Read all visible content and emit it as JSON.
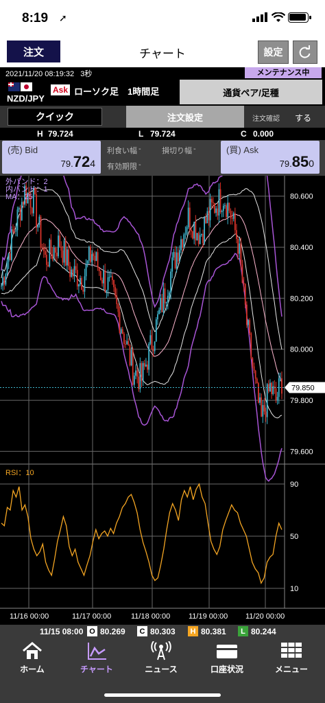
{
  "status_bar": {
    "time": "8:19",
    "location_icon": "location-arrow-icon"
  },
  "header": {
    "order_label": "注文",
    "title": "チャート",
    "settings_label": "設定",
    "refresh_icon": "refresh-icon"
  },
  "info_bar": {
    "datetime": "2021/11/20 08:19:32",
    "interval": "3秒",
    "maintenance": "メンテナンス中"
  },
  "instrument": {
    "pair": "NZD/JPY",
    "ask_tag": "Ask",
    "chart_type": "ローソク足",
    "timeframe": "1時間足",
    "pair_button": "通貨ペア/足種"
  },
  "controls": {
    "quick": "クイック",
    "order_settings": "注文設定",
    "confirm_label": "注文確認",
    "confirm_value": "する"
  },
  "hlc": {
    "h_label": "H",
    "h_value": "79.724",
    "l_label": "L",
    "l_value": "79.724",
    "c_label": "C",
    "c_value": "0.000"
  },
  "quote": {
    "bid_label": "(売) Bid",
    "bid_a": "79.",
    "bid_b": "72",
    "bid_c": "4",
    "ask_label": "(買) Ask",
    "ask_a": "79.",
    "ask_b": "85",
    "ask_c": "0",
    "take_profit": "利食い幅",
    "take_profit_val": "-",
    "stop_loss": "損切り幅",
    "stop_loss_val": "-",
    "expiry": "有効期限",
    "expiry_val": "-"
  },
  "chart_data": [
    {
      "type": "candlestick",
      "indicators": [
        "外バンド：2",
        "内バンド：1",
        "MA：25"
      ],
      "y_ticks": [
        "80.600",
        "80.400",
        "80.200",
        "80.000",
        "79.800",
        "79.600"
      ],
      "ylim": [
        79.55,
        80.68
      ],
      "current_price": "79.850",
      "x_ticks": [
        "11/16 00:00",
        "11/17 00:00",
        "11/18 00:00",
        "11/19 00:00",
        "11/20 00:00"
      ],
      "colors": {
        "up": "#3fb6cf",
        "down": "#d9342b",
        "band_outer": "#a855d6",
        "band_inner": "#e8e8e8",
        "ma": "#ffb8d0"
      }
    },
    {
      "type": "line",
      "title": "RSI：10",
      "y_ticks": [
        "90",
        "50",
        "10"
      ],
      "ylim": [
        0,
        100
      ],
      "series": [
        {
          "name": "RSI",
          "color": "#f5a623",
          "values": [
            60,
            58,
            72,
            70,
            85,
            80,
            88,
            70,
            74,
            65,
            48,
            40,
            35,
            38,
            44,
            30,
            24,
            20,
            32,
            46,
            55,
            65,
            58,
            42,
            35,
            40,
            30,
            25,
            20,
            28,
            35,
            46,
            55,
            48,
            52,
            54,
            50,
            56,
            52,
            60,
            65,
            72,
            75,
            80,
            82,
            76,
            68,
            55,
            45,
            38,
            30,
            20,
            16,
            18,
            28,
            40,
            55,
            68,
            75,
            70,
            62,
            78,
            85,
            80,
            88,
            78,
            86,
            90,
            80,
            75,
            60,
            46,
            40,
            36,
            42,
            55,
            62,
            68,
            74,
            70,
            68,
            60,
            55,
            50,
            40,
            30,
            25,
            22,
            14,
            18,
            30,
            34,
            36,
            50,
            60,
            55
          ]
        }
      ]
    }
  ],
  "ohlc": {
    "datetime": "11/15 08:00",
    "o_label": "O",
    "o_value": "80.269",
    "c_label": "C",
    "c_value": "80.303",
    "h_label": "H",
    "h_value": "80.381",
    "l_label": "L",
    "l_value": "80.244"
  },
  "tabs": [
    {
      "label": "ホーム",
      "icon": "home-icon"
    },
    {
      "label": "チャート",
      "icon": "chart-icon"
    },
    {
      "label": "ニュース",
      "icon": "antenna-icon"
    },
    {
      "label": "口座状況",
      "icon": "wallet-icon"
    },
    {
      "label": "メニュー",
      "icon": "grid-menu-icon"
    }
  ]
}
